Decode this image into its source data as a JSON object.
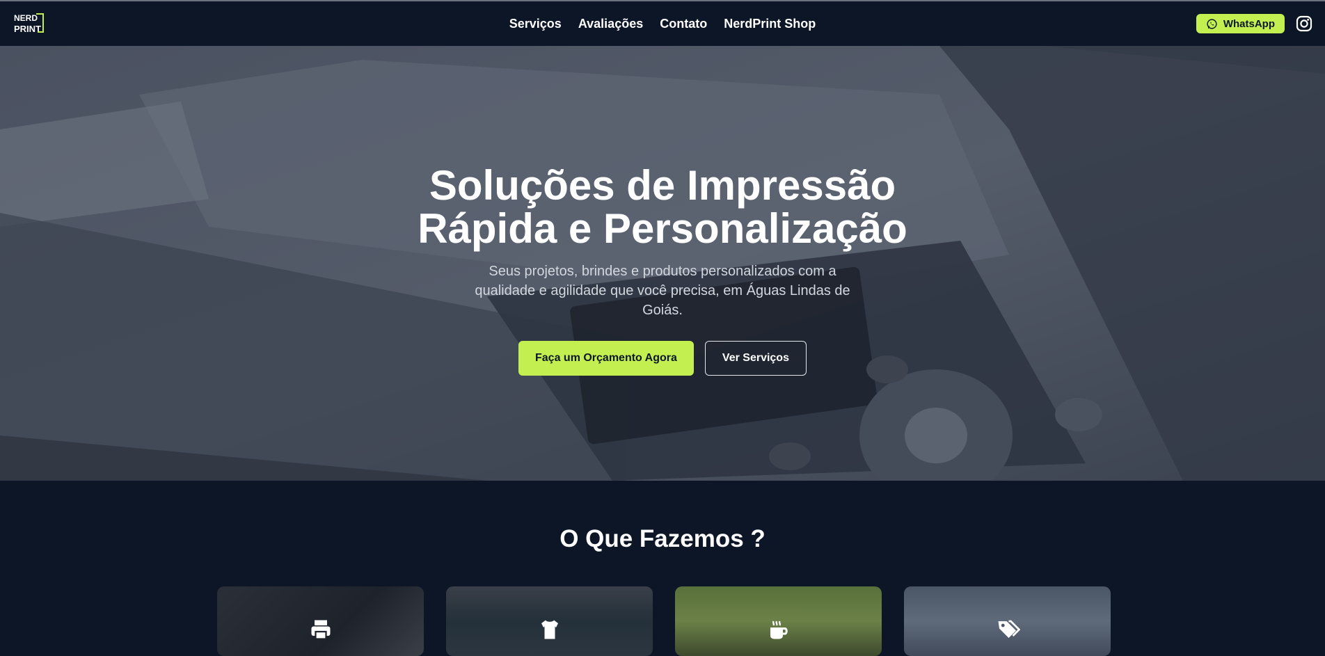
{
  "nav": {
    "logo_alt": "Nerd Print",
    "links": [
      "Serviços",
      "Avaliações",
      "Contato",
      "NerdPrint Shop"
    ],
    "whatsapp_label": "WhatsApp"
  },
  "hero": {
    "title": "Soluções de Impressão Rápida e Personalização",
    "subtitle": "Seus projetos, brindes e produtos personalizados com a qualidade e agilidade que você precisa, em Águas Lindas de Goiás.",
    "primary_button": "Faça um Orçamento Agora",
    "secondary_button": "Ver Serviços"
  },
  "services": {
    "title": "O Que Fazemos ?",
    "cards": [
      {
        "icon": "printer-icon"
      },
      {
        "icon": "tshirt-icon"
      },
      {
        "icon": "mug-icon"
      },
      {
        "icon": "tags-icon"
      }
    ]
  },
  "colors": {
    "accent": "#c3f050",
    "navbar": "#0c1626",
    "background": "#0c1626"
  }
}
